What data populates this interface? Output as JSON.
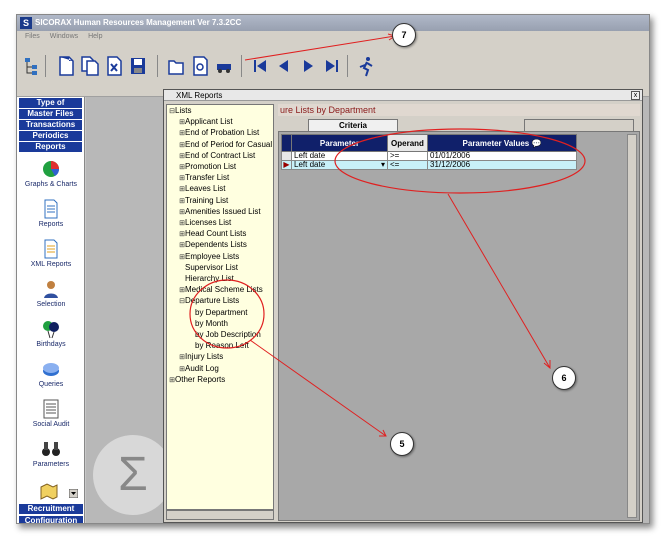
{
  "app": {
    "title": "SICORAX Human Resources Management Ver 7.3.2CC",
    "icon_letter": "S"
  },
  "menu": [
    "Files",
    "Windows",
    "Help"
  ],
  "toolbar": [
    {
      "icon": "tree-icon"
    },
    {
      "icon": "document-icon"
    },
    {
      "icon": "copy-document-icon"
    },
    {
      "icon": "delete-document-icon"
    },
    {
      "icon": "save-disk-icon"
    },
    {
      "icon": "folder-open-icon"
    },
    {
      "icon": "preview-report-icon"
    },
    {
      "icon": "vehicle-icon"
    },
    {
      "icon": "first-record-icon"
    },
    {
      "icon": "previous-record-icon"
    },
    {
      "icon": "next-record-icon"
    },
    {
      "icon": "last-record-icon"
    },
    {
      "icon": "exit-runner-icon"
    }
  ],
  "left_nav": {
    "headers": [
      "Type of",
      "Master Files",
      "Transactions",
      "Periodics",
      "Reports"
    ],
    "items": [
      "Graphs & Charts",
      "Reports",
      "XML Reports",
      "Selection",
      "Birthdays",
      "Queries",
      "Social Audit",
      "Parameters"
    ],
    "footer": [
      "Recruitment",
      "Configuration"
    ]
  },
  "xml_window": {
    "title": "XML Reports",
    "close": "x"
  },
  "tree": [
    {
      "label": "Lists",
      "pm": "⊟",
      "level": 0
    },
    {
      "label": "Applicant List",
      "pm": "⊞",
      "level": 1
    },
    {
      "label": "End of Probation List",
      "pm": "⊞",
      "level": 1
    },
    {
      "label": "End of Period for Casual I",
      "pm": "⊞",
      "level": 1
    },
    {
      "label": "End of Contract List",
      "pm": "⊞",
      "level": 1
    },
    {
      "label": "Promotion List",
      "pm": "⊞",
      "level": 1
    },
    {
      "label": "Transfer List",
      "pm": "⊞",
      "level": 1
    },
    {
      "label": "Leaves List",
      "pm": "⊞",
      "level": 1
    },
    {
      "label": "Training List",
      "pm": "⊞",
      "level": 1
    },
    {
      "label": "Amenities Issued List",
      "pm": "⊞",
      "level": 1
    },
    {
      "label": "Licenses List",
      "pm": "⊞",
      "level": 1
    },
    {
      "label": "Head Count Lists",
      "pm": "⊞",
      "level": 1
    },
    {
      "label": "Dependents Lists",
      "pm": "⊞",
      "level": 1
    },
    {
      "label": "Employee Lists",
      "pm": "⊞",
      "level": 1
    },
    {
      "label": "Supervisor List",
      "pm": "",
      "level": 1
    },
    {
      "label": "Hierarchy List",
      "pm": "",
      "level": 1
    },
    {
      "label": "Medical Scheme Lists",
      "pm": "⊞",
      "level": 1
    },
    {
      "label": "Departure Lists",
      "pm": "⊟",
      "level": 1
    },
    {
      "label": "by Department",
      "pm": "",
      "level": 2
    },
    {
      "label": "by Month",
      "pm": "",
      "level": 2
    },
    {
      "label": "by Job Description",
      "pm": "",
      "level": 2
    },
    {
      "label": "by Reason Left",
      "pm": "",
      "level": 2
    },
    {
      "label": "Injury Lists",
      "pm": "⊞",
      "level": 1
    },
    {
      "label": "Audit Log",
      "pm": "⊞",
      "level": 1
    },
    {
      "label": "Other Reports",
      "pm": "⊞",
      "level": 0
    }
  ],
  "form": {
    "title": "ure Lists by Department",
    "tab_criteria": "Criteria",
    "grid": {
      "headers": [
        "Parameter",
        "Operand",
        "Parameter Values"
      ],
      "rows": [
        {
          "parameter": "Left date",
          "operand": ">=",
          "value": "01/01/2006",
          "selected": false
        },
        {
          "parameter": "Left date",
          "operand": "<=",
          "value": "31/12/2006",
          "selected": true
        }
      ]
    }
  },
  "callouts": [
    "7",
    "6",
    "5"
  ],
  "colors": {
    "nav_header": "#1a3a9a",
    "grid_header": "#10206a",
    "annotation": "#e02020",
    "tree_bg": "#ffffe0"
  }
}
